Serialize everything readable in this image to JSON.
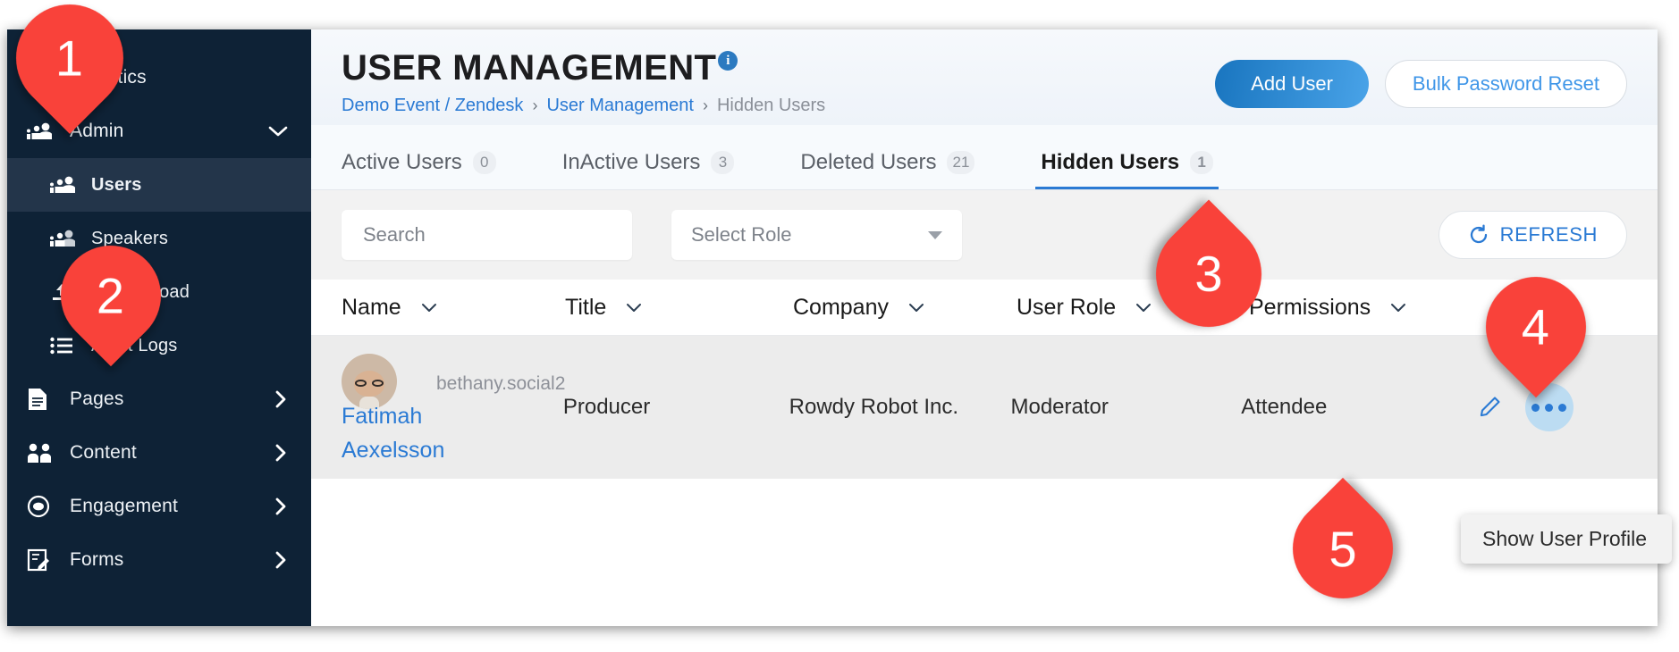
{
  "sidebar": {
    "items": [
      {
        "label": "Analytics",
        "icon": "analytics-chart-icon",
        "type": "top",
        "caret": ""
      },
      {
        "label": "Admin",
        "icon": "people-group-icon",
        "type": "top",
        "caret": "chevron-down-icon",
        "expanded": true
      },
      {
        "label": "Users",
        "icon": "people-group-icon",
        "type": "sub",
        "active": true
      },
      {
        "label": "Speakers",
        "icon": "people-group-icon",
        "type": "sub",
        "active": false
      },
      {
        "label": "Bulk Upload",
        "icon": "upload-icon",
        "type": "sub",
        "active": false
      },
      {
        "label": "Audit Logs",
        "icon": "list-icon",
        "type": "sub",
        "active": false
      },
      {
        "label": "Pages",
        "icon": "document-icon",
        "type": "top",
        "caret": "chevron-right-icon"
      },
      {
        "label": "Content",
        "icon": "two-people-icon",
        "type": "top",
        "caret": "chevron-right-icon"
      },
      {
        "label": "Engagement",
        "icon": "eye-circle-icon",
        "type": "top",
        "caret": "chevron-right-icon"
      },
      {
        "label": "Forms",
        "icon": "form-edit-icon",
        "type": "top",
        "caret": "chevron-right-icon"
      }
    ]
  },
  "header": {
    "title": "USER MANAGEMENT",
    "info_badge": "i",
    "breadcrumb": {
      "root": "Demo Event / Zendesk",
      "sep": "›",
      "middle": "User Management",
      "current": "Hidden Users"
    },
    "add_user_label": "Add User",
    "bulk_password_reset_label": "Bulk Password Reset"
  },
  "tabs": [
    {
      "label": "Active Users",
      "count": "0",
      "active": false
    },
    {
      "label": "InActive Users",
      "count": "3",
      "active": false
    },
    {
      "label": "Deleted Users",
      "count": "21",
      "active": false
    },
    {
      "label": "Hidden Users",
      "count": "1",
      "active": true
    }
  ],
  "filters": {
    "search_placeholder": "Search",
    "search_value": "",
    "role_select_value": "Select Role",
    "refresh_label": "REFRESH"
  },
  "table": {
    "columns": [
      {
        "label": "Name"
      },
      {
        "label": "Title"
      },
      {
        "label": "Company"
      },
      {
        "label": "User Role"
      },
      {
        "label": "Permissions"
      }
    ],
    "rows": [
      {
        "username": "bethany.social2",
        "first_name": "Fatimah",
        "last_name": "Aexelsson",
        "title": "Producer",
        "company": "Rowdy Robot Inc.",
        "user_role": "Moderator",
        "permissions": "Attendee"
      }
    ]
  },
  "context_menu": {
    "items": [
      {
        "label": "Show User Profile"
      }
    ]
  },
  "annotations": [
    {
      "number": "1"
    },
    {
      "number": "2"
    },
    {
      "number": "3"
    },
    {
      "number": "4"
    },
    {
      "number": "5"
    }
  ],
  "colors": {
    "sidebar_bg": "#0e2236",
    "accent_blue": "#2a7ad4",
    "annotation_red": "#f9423a",
    "row_bg": "#ececec"
  }
}
